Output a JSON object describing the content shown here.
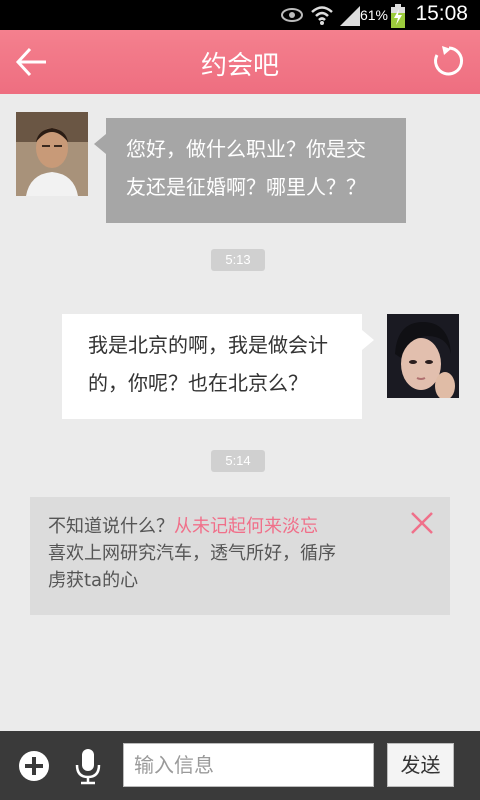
{
  "status_bar": {
    "battery_percent": "61%",
    "time": "15:08",
    "icons": [
      "eye-icon",
      "wifi-icon",
      "signal-icon",
      "battery-charging-icon"
    ]
  },
  "header": {
    "title": "约会吧",
    "back_icon": "arrow-left-icon",
    "refresh_icon": "refresh-icon",
    "background": "#f07586"
  },
  "messages": [
    {
      "side": "left",
      "lines": [
        "您好，做什么职业？你是交",
        "友还是征婚啊？哪里人？？"
      ]
    },
    {
      "timestamp": "5:13"
    },
    {
      "side": "right",
      "lines": [
        "我是北京的啊，我是做会计",
        "的，你呢？也在北京么？"
      ]
    },
    {
      "timestamp": "5:14"
    }
  ],
  "suggestion": {
    "prefix": "不知道说什么？",
    "highlight": "从未记起何来淡忘",
    "line2": "喜欢上网研究汽车，透气所好，循序",
    "line3": "虏获ta的心",
    "highlight_color": "#f0708a"
  },
  "input_bar": {
    "placeholder": "输入信息",
    "send_label": "发送",
    "plus_icon": "plus-circle-icon",
    "mic_icon": "microphone-icon"
  }
}
